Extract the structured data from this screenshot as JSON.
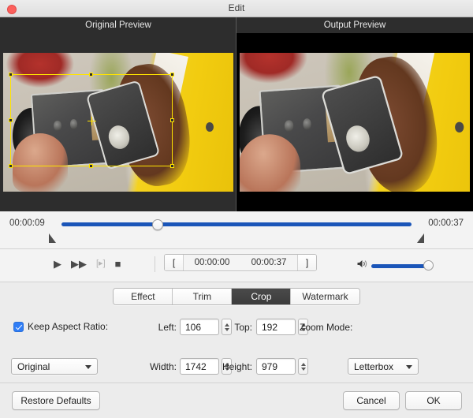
{
  "window": {
    "title": "Edit",
    "close_button": "close-button"
  },
  "previews": {
    "original_label": "Original Preview",
    "output_label": "Output Preview"
  },
  "timeline": {
    "start_time": "00:00:09",
    "end_time": "00:00:37",
    "playhead_percent": 28
  },
  "transport": {
    "play": "▶",
    "fast_forward": "▶▶",
    "step": "[▸]",
    "stop": "■",
    "mark_in_bracket": "[",
    "mark_out_bracket": "]",
    "in_time": "00:00:00",
    "out_time": "00:00:37",
    "speaker": "🔊",
    "volume_percent": 100
  },
  "tabs": [
    {
      "label": "Effect",
      "active": false
    },
    {
      "label": "Trim",
      "active": false
    },
    {
      "label": "Crop",
      "active": true
    },
    {
      "label": "Watermark",
      "active": false
    }
  ],
  "crop_form": {
    "keep_aspect_label": "Keep Aspect Ratio:",
    "keep_aspect_checked": true,
    "aspect_ratio_value": "Original",
    "left_label": "Left:",
    "left_value": "106",
    "top_label": "Top:",
    "top_value": "192",
    "width_label": "Width:",
    "width_value": "1742",
    "height_label": "Height:",
    "height_value": "979",
    "zoom_mode_label": "Zoom Mode:",
    "zoom_mode_value": "Letterbox"
  },
  "footer": {
    "restore_label": "Restore Defaults",
    "cancel_label": "Cancel",
    "ok_label": "OK"
  },
  "colors": {
    "accent_blue": "#1a55b8",
    "crop_yellow": "#ffe400",
    "checkbox_blue": "#2f7df6",
    "active_tab": "#3f3f3f"
  }
}
